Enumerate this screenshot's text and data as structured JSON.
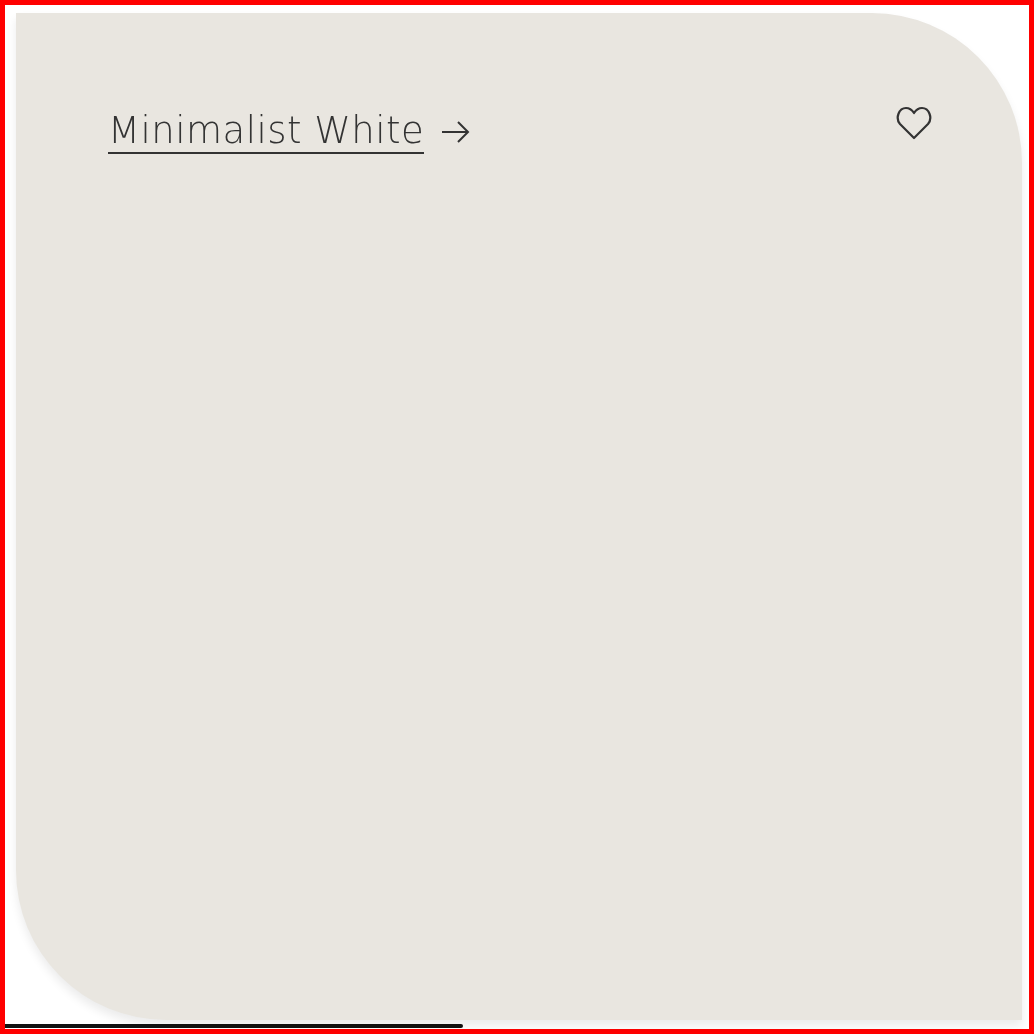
{
  "card": {
    "title": "Minimalist White",
    "color": "#e9e6e0",
    "favorite": false
  }
}
